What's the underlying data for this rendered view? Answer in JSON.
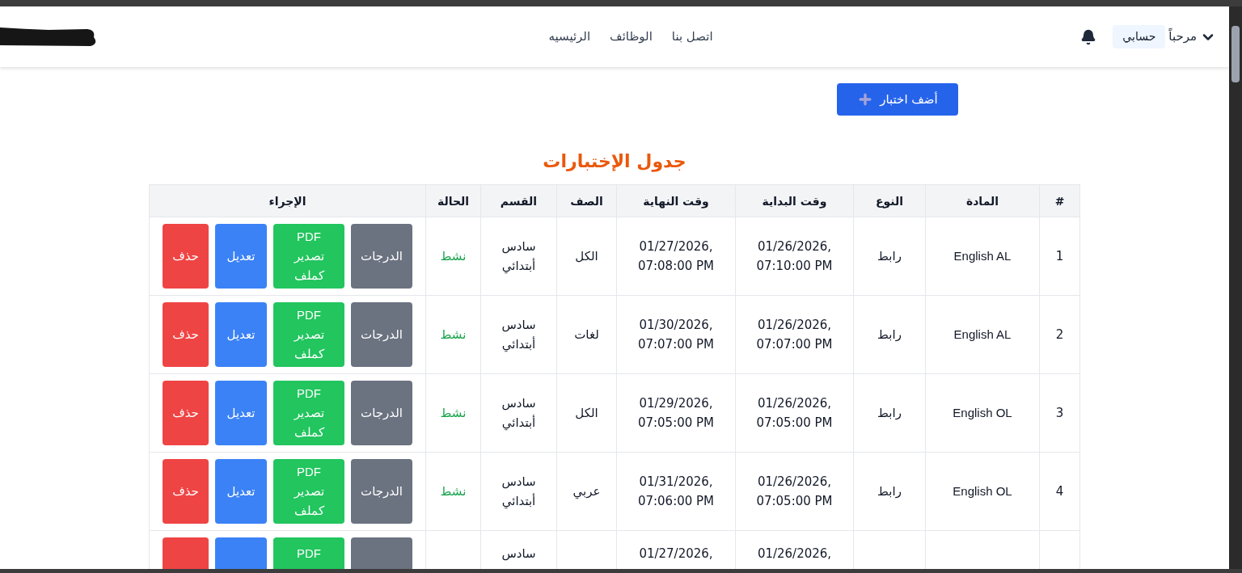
{
  "navbar": {
    "account": {
      "greeting": "مرحباً",
      "name": "حسابي"
    },
    "links": [
      "اتصل بنا",
      "الوظائف",
      "الرئيسيه"
    ]
  },
  "add_button": {
    "label": "أضف اختبار"
  },
  "title": "جدول الإختبارات",
  "table": {
    "columns": [
      "#",
      "المادة",
      "النوع",
      "وقت البداية",
      "وقت النهاية",
      "الصف",
      "القسم",
      "الحالة",
      "الإجراء"
    ],
    "rows": [
      {
        "num": "1",
        "subject": "English AL",
        "type": "رابط",
        "start": "01/26/2026, 07:10:00 PM",
        "end": "01/27/2026, 07:08:00 PM",
        "grade": "الكل",
        "section": "سادس أبتدائي",
        "status": "نشط",
        "actions": [
          {
            "kind": "grades",
            "label": "الدرجات"
          },
          {
            "kind": "export",
            "label": "PDF تصدير كملف"
          },
          {
            "kind": "edit",
            "label": "تعديل"
          },
          {
            "kind": "delete",
            "label": "حذف"
          }
        ]
      },
      {
        "num": "2",
        "subject": "English AL",
        "type": "رابط",
        "start": "01/26/2026, 07:07:00 PM",
        "end": "01/30/2026, 07:07:00 PM",
        "grade": "لغات",
        "section": "سادس أبتدائي",
        "status": "نشط",
        "actions": [
          {
            "kind": "grades",
            "label": "الدرجات"
          },
          {
            "kind": "export",
            "label": "PDF تصدير كملف"
          },
          {
            "kind": "edit",
            "label": "تعديل"
          },
          {
            "kind": "delete",
            "label": "حذف"
          }
        ]
      },
      {
        "num": "3",
        "subject": "English OL",
        "type": "رابط",
        "start": "01/26/2026, 07:05:00 PM",
        "end": "01/29/2026, 07:05:00 PM",
        "grade": "الكل",
        "section": "سادس أبتدائي",
        "status": "نشط",
        "actions": [
          {
            "kind": "grades",
            "label": "الدرجات"
          },
          {
            "kind": "export",
            "label": "PDF تصدير كملف"
          },
          {
            "kind": "edit",
            "label": "تعديل"
          },
          {
            "kind": "delete",
            "label": "حذف"
          }
        ]
      },
      {
        "num": "4",
        "subject": "English OL",
        "type": "رابط",
        "start": "01/26/2026, 07:05:00 PM",
        "end": "01/31/2026, 07:06:00 PM",
        "grade": "عربي",
        "section": "سادس أبتدائي",
        "status": "نشط",
        "actions": [
          {
            "kind": "grades",
            "label": "الدرجات"
          },
          {
            "kind": "export",
            "label": "PDF تصدير كملف"
          },
          {
            "kind": "edit",
            "label": "تعديل"
          },
          {
            "kind": "delete",
            "label": "حذف"
          }
        ]
      },
      {
        "start": "01/26/2026,",
        "end": "01/27/2026,",
        "section": "سادس",
        "actions": [
          {
            "kind": "grades"
          },
          {
            "kind": "export",
            "label": "PDF"
          },
          {
            "kind": "edit"
          },
          {
            "kind": "delete"
          }
        ]
      }
    ]
  }
}
